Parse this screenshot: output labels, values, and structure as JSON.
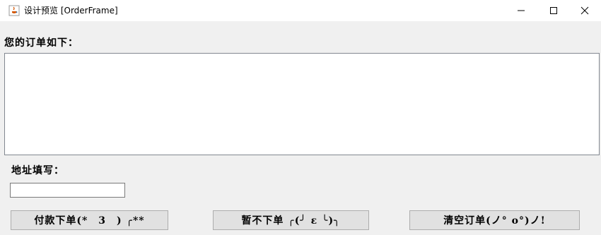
{
  "window": {
    "title": "设计预览 [OrderFrame]"
  },
  "order": {
    "label": "您的订单如下：",
    "content": ""
  },
  "address": {
    "label": "地址填写：",
    "value": ""
  },
  "buttons": {
    "pay": "付款下单(*　3　) ╭**",
    "later": "暂不下单 ╭(╯ ε ╰)╮",
    "clear": "清空订单(ノ° o°)ノ!"
  },
  "icons": {
    "app": "java-coffee-icon",
    "minimize": "minimize-icon",
    "maximize": "maximize-icon",
    "close": "close-icon"
  }
}
